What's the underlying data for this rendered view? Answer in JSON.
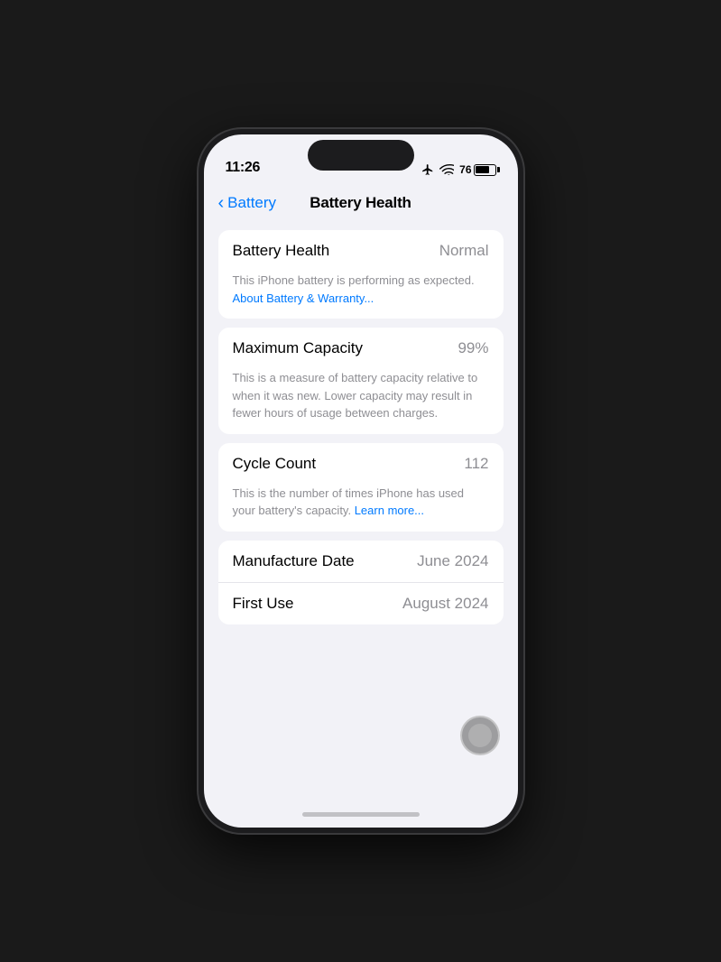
{
  "status_bar": {
    "time": "11:26",
    "battery_percent": "76"
  },
  "navigation": {
    "back_label": "Battery",
    "title": "Battery Health"
  },
  "sections": {
    "battery_health": {
      "label": "Battery Health",
      "value": "Normal",
      "description_text": "This iPhone battery is performing as expected.",
      "description_link": "About Battery & Warranty..."
    },
    "maximum_capacity": {
      "label": "Maximum Capacity",
      "value": "99%",
      "description": "This is a measure of battery capacity relative to when it was new. Lower capacity may result in fewer hours of usage between charges."
    },
    "cycle_count": {
      "label": "Cycle Count",
      "value": "112",
      "description_text": "This is the number of times iPhone has used your battery's capacity.",
      "description_link": "Learn more..."
    },
    "manufacture_date": {
      "label": "Manufacture Date",
      "value": "June 2024"
    },
    "first_use": {
      "label": "First Use",
      "value": "August 2024"
    }
  }
}
